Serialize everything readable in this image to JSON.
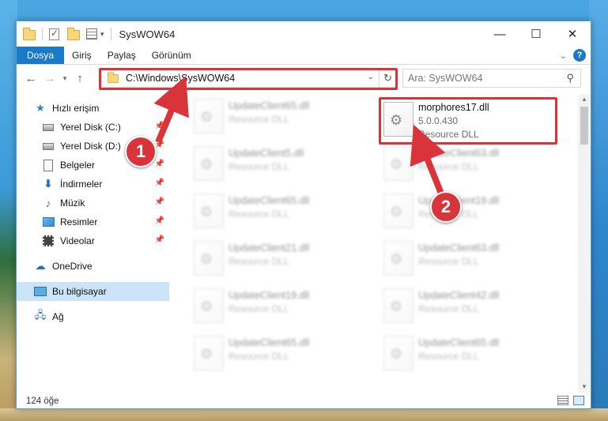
{
  "window": {
    "title": "SysWOW64",
    "controls": [
      "—",
      "☐",
      "✕"
    ]
  },
  "ribbon": {
    "tabs": [
      "Dosya",
      "Giriş",
      "Paylaş",
      "Görünüm"
    ]
  },
  "address": {
    "path": "C:\\Windows\\SysWOW64",
    "search_placeholder": "Ara: SysWOW64"
  },
  "sidebar": {
    "items": [
      {
        "label": "Hızlı erişim",
        "icon": "star-icon"
      },
      {
        "label": "Yerel Disk (C:)",
        "icon": "disk-icon",
        "pinned": true
      },
      {
        "label": "Yerel Disk (D:)",
        "icon": "disk-icon",
        "pinned": true
      },
      {
        "label": "Belgeler",
        "icon": "document-icon",
        "pinned": true
      },
      {
        "label": "İndirmeler",
        "icon": "download-icon",
        "pinned": true
      },
      {
        "label": "Müzik",
        "icon": "music-icon",
        "pinned": true
      },
      {
        "label": "Resimler",
        "icon": "pictures-icon",
        "pinned": true
      },
      {
        "label": "Videolar",
        "icon": "videos-icon",
        "pinned": true
      },
      {
        "label": "OneDrive",
        "icon": "cloud-icon"
      },
      {
        "label": "Bu bilgisayar",
        "icon": "computer-icon",
        "selected": true
      },
      {
        "label": "Ağ",
        "icon": "network-icon"
      }
    ]
  },
  "files": {
    "highlighted": {
      "name": "morphores17.dll",
      "version": "5.0.0.430",
      "type": "Resource DLL"
    },
    "left_column": [
      {
        "name": "UpdateClient65.dll",
        "type": "Resource DLL"
      },
      {
        "name": "UpdateClient5.dll",
        "type": "Resource DLL"
      },
      {
        "name": "UpdateClient65.dll",
        "type": "Resource DLL"
      },
      {
        "name": "UpdateClient21.dll",
        "type": "Resource DLL"
      },
      {
        "name": "UpdateClient19.dll",
        "type": "Resource DLL"
      },
      {
        "name": "UpdateClient65.dll",
        "type": "Resource DLL"
      }
    ],
    "right_column": [
      {
        "name": "UpdateClient63.dll",
        "type": "Resource DLL"
      },
      {
        "name": "UpdateClient19.dll",
        "type": "Resource DLL"
      },
      {
        "name": "UpdateClient63.dll",
        "type": "Resource DLL"
      },
      {
        "name": "UpdateClient42.dll",
        "type": "Resource DLL"
      },
      {
        "name": "UpdateClient65.dll",
        "type": "Resource DLL"
      }
    ]
  },
  "status": {
    "count": "124 öğe"
  },
  "callouts": {
    "one": "1",
    "two": "2",
    "color": "#d9343a"
  },
  "colors": {
    "accent": "#1979ca",
    "highlight": "#d9343a",
    "selected_bg": "#cce4f7"
  }
}
